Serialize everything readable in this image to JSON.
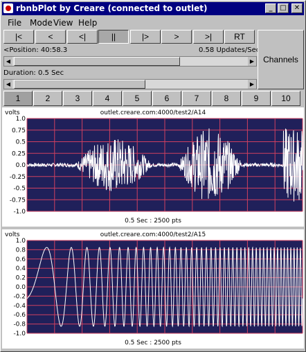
{
  "window": {
    "title": "rbnbPlot by Creare (connected to outlet)",
    "minimize_glyph": "_",
    "maximize_glyph": "□",
    "close_glyph": "✕"
  },
  "menu": [
    "File",
    "Mode",
    "View",
    "Help"
  ],
  "controls": {
    "buttons": [
      "|<",
      "<",
      "<|",
      "||",
      "|>",
      ">",
      ">|",
      "RT"
    ],
    "pressed_index": 3,
    "position_label": "<Position: 40:58.3",
    "updates_label": "0.58 Updates/Sec",
    "duration_label": "Duration:  0.5 Sec",
    "channels_button": "Channels"
  },
  "channel_tabs": [
    "1",
    "2",
    "3",
    "4",
    "5",
    "6",
    "7",
    "8",
    "9",
    "10"
  ],
  "active_tab": 0,
  "plots": [
    {
      "units": "volts",
      "channel": "outlet.creare.com:4000/test2/A14",
      "footer": "0.5 Sec : 2500 pts",
      "ticks": [
        "1.0",
        "0.75",
        "0.5",
        "0.25",
        "0.0",
        "-0.25",
        "-0.5",
        "-0.75",
        "-1.0"
      ]
    },
    {
      "units": "volts",
      "channel": "outlet.creare.com:4000/test2/A15",
      "footer": "0.5 Sec : 2500 pts",
      "ticks": [
        "1.0",
        "0.8",
        "0.6",
        "0.4",
        "0.2",
        "0.0",
        "-0.2",
        "-0.4",
        "-0.6",
        "-0.8",
        "-1.0"
      ]
    }
  ],
  "colors": {
    "plot_bg": "#20205a",
    "grid": "#d04060",
    "trace": "#ffffff",
    "titlebar": "#000080"
  }
}
